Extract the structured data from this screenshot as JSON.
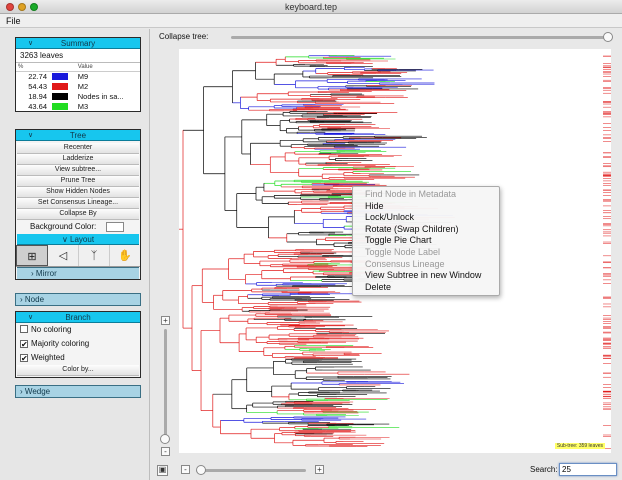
{
  "window": {
    "title": "keyboard.tep"
  },
  "menubar": {
    "file": "File"
  },
  "summary": {
    "header": "Summary",
    "leaves": "3263 leaves",
    "col_pct": "%",
    "col_value": "Value",
    "rows": [
      {
        "pct": "22.74",
        "value": "M9",
        "color": "#1a1adc"
      },
      {
        "pct": "54.43",
        "value": "M2",
        "color": "#e01818"
      },
      {
        "pct": "18.94",
        "value": "Nodes in sa...",
        "color": "#000000"
      },
      {
        "pct": "43.64",
        "value": "M3",
        "color": "#22dd22"
      }
    ]
  },
  "tree": {
    "header": "Tree",
    "buttons": [
      "Recenter",
      "Ladderize",
      "View subtree...",
      "Prune Tree",
      "Show Hidden Nodes",
      "Set Consensus Lineage...",
      "Collapse By"
    ],
    "bg_label": "Background Color:",
    "bg_color": "#ffffff"
  },
  "layout": {
    "header": "Layout",
    "icons": [
      "rectangular-layout-icon",
      "triangular-layout-icon",
      "radial-layout-icon",
      "pan-hand-icon"
    ],
    "selected": 0,
    "mirror": "Mirror"
  },
  "node": {
    "header": "Node"
  },
  "branch": {
    "header": "Branch",
    "options": [
      {
        "label": "No coloring",
        "checked": false
      },
      {
        "label": "Majority coloring",
        "checked": true
      },
      {
        "label": "Weighted",
        "checked": true
      }
    ],
    "color_by": "Color by..."
  },
  "wedge": {
    "header": "Wedge"
  },
  "main": {
    "collapse_label": "Collapse tree:",
    "collapse_level": 1.0,
    "subtree_label": "Sub-tree: 359 leaves",
    "search_label": "Search:",
    "search_value": "25",
    "zoom_minus": "-",
    "zoom_plus": "+",
    "zoom_level": 0.0,
    "vzoom_plus": "+",
    "vzoom_minus": "-"
  },
  "context_menu": [
    {
      "label": "Find Node in Metadata",
      "enabled": false
    },
    {
      "label": "Hide",
      "enabled": true
    },
    {
      "label": "Lock/Unlock",
      "enabled": true
    },
    {
      "label": "Rotate (Swap Children)",
      "enabled": true
    },
    {
      "label": "Toggle Pie Chart",
      "enabled": true
    },
    {
      "label": "Toggle Node Label",
      "enabled": false
    },
    {
      "label": "Consensus Lineage",
      "enabled": false
    },
    {
      "label": "View Subtree in new Window",
      "enabled": true
    },
    {
      "label": "Delete",
      "enabled": true
    }
  ]
}
